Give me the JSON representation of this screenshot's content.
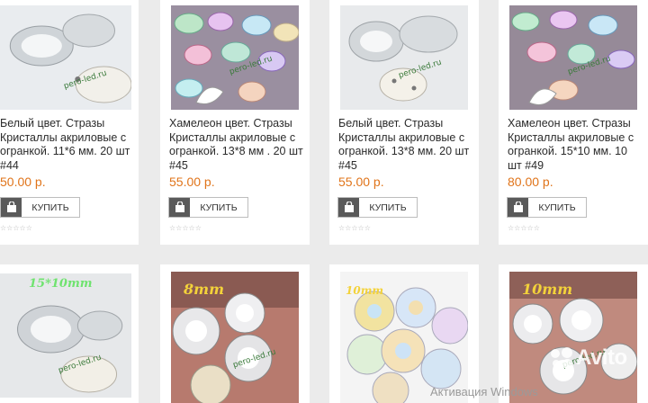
{
  "products": [
    {
      "title": "Белый цвет. Стразы Кристаллы акриловые с огранкой. 11*6 мм. 20 шт #44",
      "price": "50.00 р.",
      "buy_label": "КУПИТЬ",
      "watermark": "pero-led.ru",
      "overlay": ""
    },
    {
      "title": "Хамелеон цвет. Стразы Кристаллы акриловые с огранкой. 13*8 мм . 20 шт #45",
      "price": "55.00 р.",
      "buy_label": "КУПИТЬ",
      "watermark": "pero-led.ru",
      "overlay": ""
    },
    {
      "title": "Белый цвет. Стразы Кристаллы акриловые с огранкой. 13*8 мм. 20 шт #45",
      "price": "55.00 р.",
      "buy_label": "КУПИТЬ",
      "watermark": "pero-led.ru",
      "overlay": ""
    },
    {
      "title": "Хамелеон цвет. Стразы Кристаллы акриловые с огранкой. 15*10 мм. 10 шт #49",
      "price": "80.00 р.",
      "buy_label": "КУПИТЬ",
      "watermark": "pero-led.ru",
      "overlay": ""
    },
    {
      "title": "",
      "price": "",
      "buy_label": "",
      "watermark": "pero-led.ru",
      "overlay": "15*10mm"
    },
    {
      "title": "",
      "price": "",
      "buy_label": "",
      "watermark": "pero-led.ru",
      "overlay": "8mm"
    },
    {
      "title": "",
      "price": "",
      "buy_label": "",
      "watermark": "",
      "overlay": "10mm"
    },
    {
      "title": "",
      "price": "",
      "buy_label": "",
      "watermark": "pero-led.ru",
      "overlay": "10mm"
    }
  ],
  "rating_stars": "☆☆☆☆☆",
  "system": {
    "activation_text": "Активация Windows",
    "avito_logo": "Avito"
  },
  "colors": {
    "price": "#e0741a",
    "overlay_green": "#6fe36f",
    "overlay_yellow": "#f3d23a"
  },
  "icons": [
    "shopping-bag-icon",
    "star-icon"
  ]
}
